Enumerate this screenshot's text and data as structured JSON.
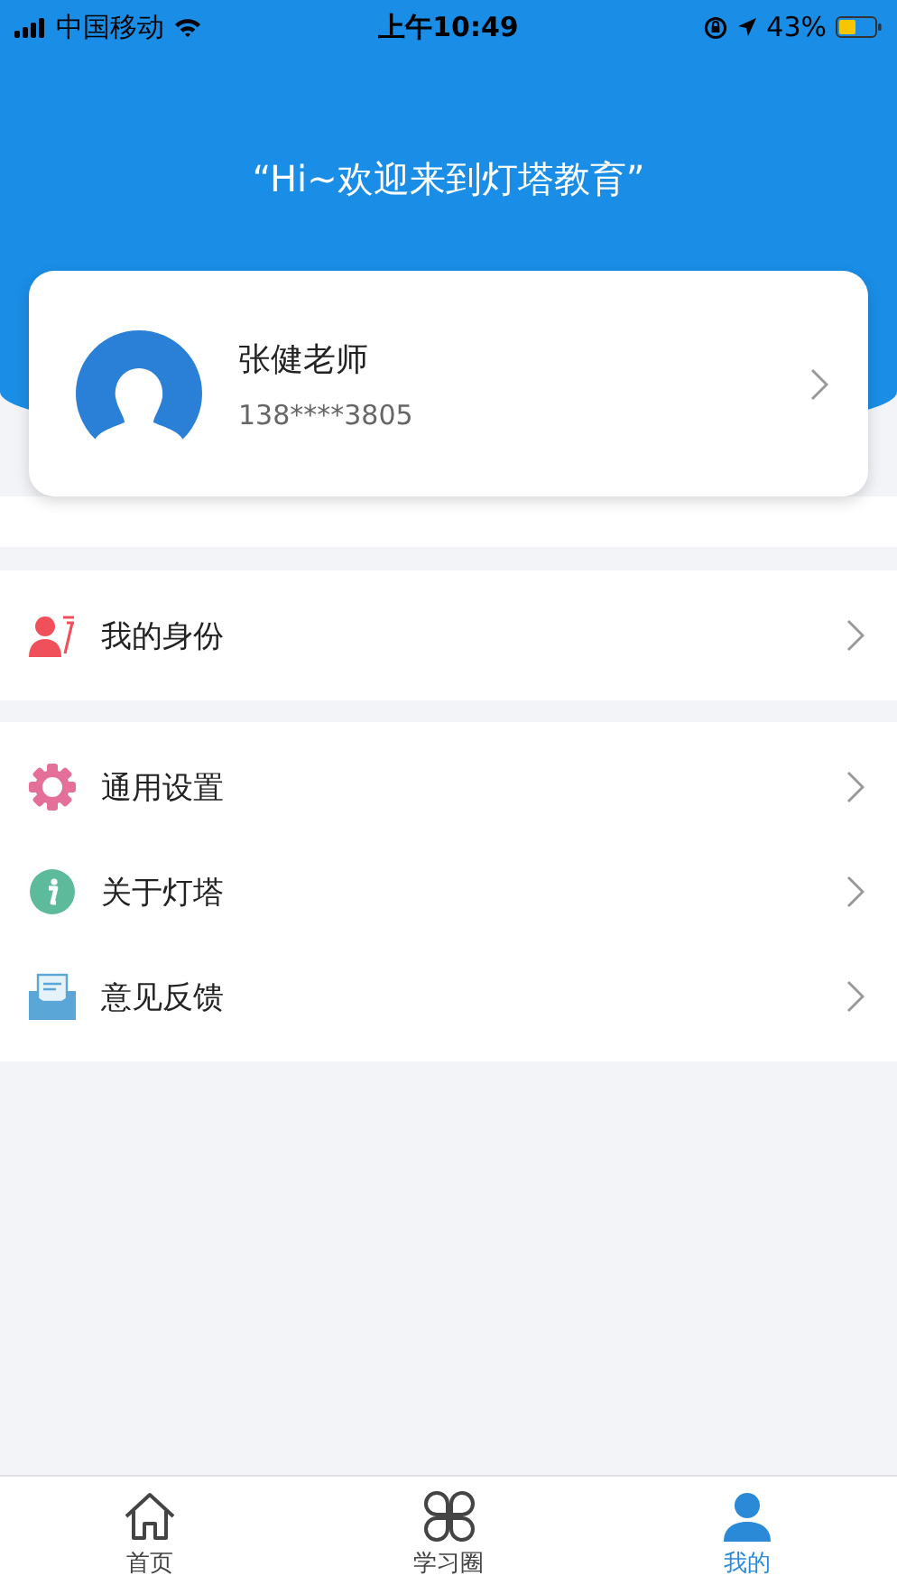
{
  "status_bar": {
    "carrier": "中国移动",
    "time": "上午10:49",
    "battery": "43%"
  },
  "header": {
    "greeting": "“Hi~欢迎来到灯塔教育”"
  },
  "profile": {
    "name": "张健老师",
    "phone": "138****3805"
  },
  "menu_groups": [
    [
      {
        "kind": "identity",
        "label": "我的身份"
      }
    ],
    [
      {
        "kind": "settings",
        "label": "通用设置"
      },
      {
        "kind": "about",
        "label": "关于灯塔"
      },
      {
        "kind": "feedback",
        "label": "意见反馈"
      }
    ]
  ],
  "tabs": [
    {
      "kind": "home",
      "label": "首页",
      "selected": false
    },
    {
      "kind": "circle",
      "label": "学习圈",
      "selected": false
    },
    {
      "kind": "me",
      "label": "我的",
      "selected": true
    }
  ]
}
